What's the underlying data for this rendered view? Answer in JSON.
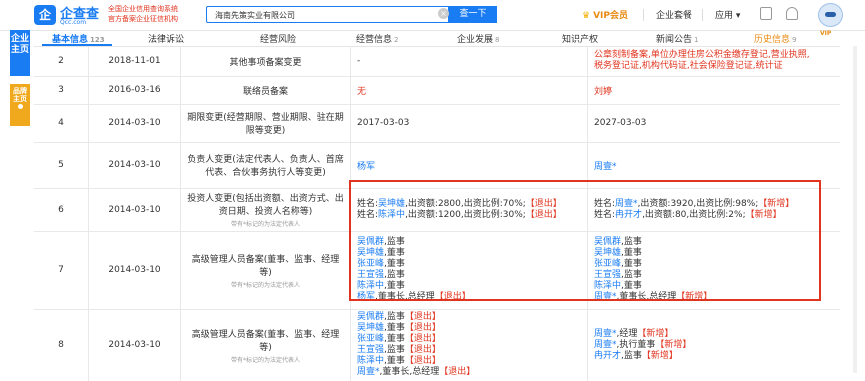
{
  "header": {
    "logo_mark": "企",
    "logo_text": "企查查",
    "logo_sub": "Qcc.com",
    "slogan_line1": "全国企业信用查询系统",
    "slogan_line2": "官方备案企业征信机构",
    "search_value": "海南先策实业有限公司",
    "search_button": "查一下",
    "vip_label": "VIP会员",
    "nav_suite": "企业套餐",
    "nav_apps": "应用 ▾"
  },
  "side": {
    "main_label": "企业主页",
    "brand_label": "品牌主页"
  },
  "tabs": [
    {
      "label": "基本信息",
      "count": "123"
    },
    {
      "label": "法律诉讼",
      "count": ""
    },
    {
      "label": "经营风险",
      "count": ""
    },
    {
      "label": "经营信息",
      "count": "2"
    },
    {
      "label": "企业发展",
      "count": "8"
    },
    {
      "label": "知识产权",
      "count": ""
    },
    {
      "label": "新闻公告",
      "count": "1"
    },
    {
      "label": "历史信息",
      "count": "9"
    }
  ],
  "vip_badge": "VIP",
  "rows": [
    {
      "num": "2",
      "date": "2018-11-01",
      "item": "其他事项备案变更",
      "sub": "",
      "before": [
        "-"
      ],
      "after_red": [
        "公章刻制备案,单位办理住房公积金缴存登记,营业执照,",
        "税务登记证,机构代码证,社会保险登记证,统计证"
      ]
    },
    {
      "num": "3",
      "date": "2016-03-16",
      "item": "联络员备案",
      "sub": "",
      "before_red": "无",
      "after_red_single": "刘婷"
    },
    {
      "num": "4",
      "date": "2014-03-10",
      "item": "期限变更(经营期限、营业期限、驻在期限等变更)",
      "sub": "",
      "before": [
        "2017-03-03"
      ],
      "after": [
        "2027-03-03"
      ]
    },
    {
      "num": "5",
      "date": "2014-03-10",
      "item": "负责人变更(法定代表人、负责人、首席代表、合伙事务执行人等变更)",
      "sub": "",
      "before_link": "杨军",
      "after_link": "周壹*"
    },
    {
      "num": "6",
      "date": "2014-03-10",
      "item": "投资人变更(包括出资额、出资方式、出资日期、投资人名称等)",
      "sub": "带有*标记的为法定代表人",
      "before_lines": [
        {
          "name": "吴坤雄",
          "rest": ",出资额:2800,出资比例:70%;",
          "tag": "【退出】"
        },
        {
          "name": "陈泽中",
          "rest": ",出资额:1200,出资比例:30%;",
          "tag": "【退出】"
        }
      ],
      "after_lines": [
        {
          "name": "周壹*",
          "rest": ",出资额:3920,出资比例:98%;",
          "tag": "【新增】"
        },
        {
          "name": "冉开才",
          "rest": ",出资额:80,出资比例:2%;",
          "tag": "【新增】"
        }
      ]
    },
    {
      "num": "7",
      "date": "2014-03-10",
      "item": "高级管理人员备案(董事、监事、经理等)",
      "sub": "带有*标记的为法定代表人",
      "before_people": [
        {
          "name": "吴佩群",
          "role": ",监事",
          "tag": ""
        },
        {
          "name": "吴坤雄",
          "role": ",董事",
          "tag": ""
        },
        {
          "name": "张亚峰",
          "role": ",董事",
          "tag": ""
        },
        {
          "name": "王宣强",
          "role": ",监事",
          "tag": ""
        },
        {
          "name": "陈泽中",
          "role": ",董事",
          "tag": ""
        },
        {
          "name": "杨军",
          "role": ",董事长,总经理",
          "tag": "【退出】"
        }
      ],
      "after_people": [
        {
          "name": "吴佩群",
          "role": ",监事",
          "tag": ""
        },
        {
          "name": "吴坤雄",
          "role": ",董事",
          "tag": ""
        },
        {
          "name": "张亚峰",
          "role": ",董事",
          "tag": ""
        },
        {
          "name": "王宣强",
          "role": ",监事",
          "tag": ""
        },
        {
          "name": "陈泽中",
          "role": ",董事",
          "tag": ""
        },
        {
          "name": "周壹*",
          "role": ",董事长,总经理",
          "tag": "【新增】"
        }
      ]
    },
    {
      "num": "8",
      "date": "2014-03-10",
      "item": "高级管理人员备案(董事、监事、经理等)",
      "sub": "带有*标记的为法定代表人",
      "before_people": [
        {
          "name": "吴佩群",
          "role": ",监事",
          "tag": "【退出】"
        },
        {
          "name": "吴坤雄",
          "role": ",董事",
          "tag": "【退出】"
        },
        {
          "name": "张亚峰",
          "role": ",董事",
          "tag": "【退出】"
        },
        {
          "name": "王宣强",
          "role": ",监事",
          "tag": "【退出】"
        },
        {
          "name": "陈泽中",
          "role": ",董事",
          "tag": "【退出】"
        },
        {
          "name": "周壹*",
          "role": ",董事长,总经理",
          "tag": "【退出】"
        }
      ],
      "after_people": [
        {
          "name": "周壹*",
          "role": ",经理",
          "tag": "【新增】"
        },
        {
          "name": "周壹*",
          "role": ",执行董事",
          "tag": "【新增】"
        },
        {
          "name": "冉开才",
          "role": ",监事",
          "tag": "【新增】"
        }
      ]
    }
  ]
}
